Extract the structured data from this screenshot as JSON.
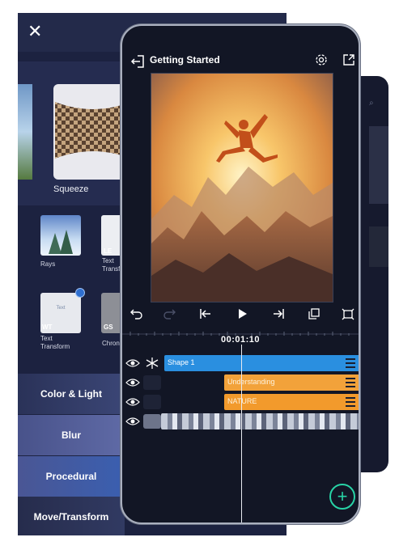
{
  "effects_panel": {
    "close_icon": "close-icon",
    "featured_label": "Squeeze",
    "effects": [
      {
        "tag": "",
        "label": "Rays"
      },
      {
        "tag": "LE",
        "label": "Text Transform"
      },
      {
        "tag": "WT",
        "label": "Text Transform"
      },
      {
        "tag": "GS",
        "label": "Chron"
      }
    ],
    "categories": [
      {
        "label": "Color & Light",
        "color": "#2b3257"
      },
      {
        "label": "Blur",
        "color": "#3a4372"
      },
      {
        "label": "Procedural",
        "color": "#39427a"
      },
      {
        "label": "Move/Transform",
        "color": "#2a3052"
      }
    ]
  },
  "editor": {
    "back_icon": "exit-icon",
    "title": "Getting Started",
    "settings_icon": "gear-icon",
    "export_icon": "share-icon",
    "toolbar": [
      "undo-icon",
      "redo-icon",
      "skip-back-icon",
      "play-icon",
      "skip-forward-icon",
      "duplicate-icon",
      "crop-icon"
    ],
    "timecode": "00:01:10",
    "tracks": [
      {
        "name": "Shape 1",
        "color": "#2a8fe0"
      },
      {
        "name": "Understanding",
        "color": "#f2a23a"
      },
      {
        "name": "NATURE",
        "color": "#f29a2c"
      },
      {
        "name": "",
        "color": "#8e96ab"
      }
    ],
    "add_icon": "plus-icon",
    "accent": "#28d3a6"
  }
}
